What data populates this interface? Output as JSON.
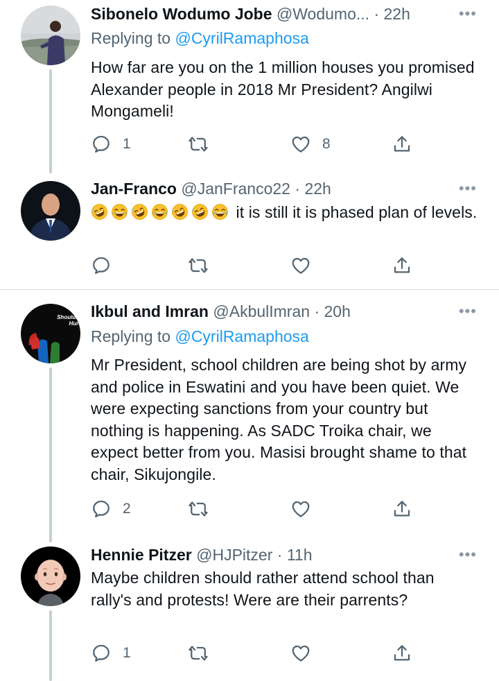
{
  "tweets": [
    {
      "name": "Sibonelo Wodumo Jobe",
      "handle": "@Wodumo...",
      "dot": "·",
      "time": "22h",
      "replying_prefix": "Replying to ",
      "replying_to": "@CyrilRamaphosa",
      "text": "How far are you on the 1 million houses you promised Alexander people in 2018 Mr President? Angilwi Mongameli!",
      "reply_count": "1",
      "retweet_count": "",
      "like_count": "8"
    },
    {
      "name": "Jan-Franco",
      "handle": "@JanFranco22",
      "dot": "·",
      "time": "22h",
      "emojis": [
        "rofl",
        "joy",
        "rofl",
        "joy",
        "rofl",
        "rofl",
        "joy"
      ],
      "text": "it is still it is phased plan of levels.",
      "reply_count": "",
      "retweet_count": "",
      "like_count": ""
    },
    {
      "name": "Ikbul and Imran",
      "handle": "@AkbulImran",
      "dot": "·",
      "time": "20h",
      "replying_prefix": "Replying to ",
      "replying_to": "@CyrilRamaphosa",
      "avatar_text": [
        "Ho",
        "Shouldn'",
        "Hurt"
      ],
      "text": "Mr President, school children are being shot by army and police in Eswatini and you have been quiet. We were expecting sanctions from your country but nothing is happening. As SADC Troika chair, we expect better from you. Masisi brought shame to that chair, Sikujongile.",
      "reply_count": "2",
      "retweet_count": "",
      "like_count": ""
    },
    {
      "name": "Hennie Pitzer",
      "handle": "@HJPitzer",
      "dot": "·",
      "time": "11h",
      "text": "Maybe children should rather attend school than rally's and protests! Were are their parrents?",
      "reply_count": "1",
      "retweet_count": "",
      "like_count": ""
    }
  ],
  "icons": {
    "reply": "reply-icon",
    "retweet": "retweet-icon",
    "like": "heart-icon",
    "share": "share-icon",
    "more": "more-icon"
  },
  "colors": {
    "link": "#1d9bf0",
    "secondary_text": "#536471",
    "thread_line": "#c4cfd6",
    "separator": "#cfd9de"
  }
}
